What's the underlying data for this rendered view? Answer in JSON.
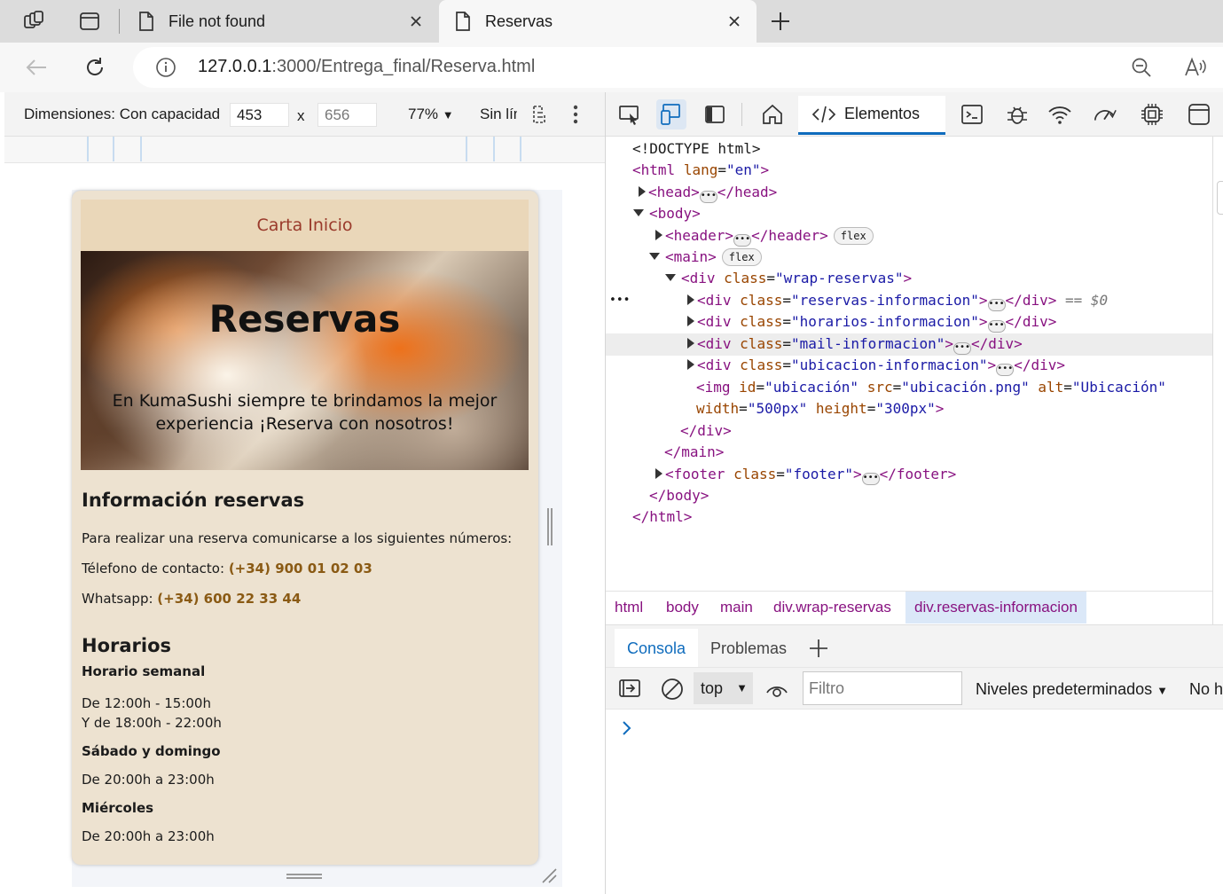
{
  "browser": {
    "tabs": [
      {
        "title": "File not found"
      },
      {
        "title": "Reservas"
      }
    ],
    "url": {
      "host": "127.0.0.1",
      "path": ":3000/Entrega_final/Reserva.html"
    }
  },
  "device_toolbar": {
    "dimensions_label": "Dimensiones: Con capacidad",
    "width": "453",
    "times": "x",
    "height": "656",
    "zoom": "77%",
    "throttle": "Sin límite"
  },
  "site": {
    "nav": [
      "Carta",
      "Inicio"
    ],
    "hero_title": "Reservas",
    "hero_text": "En KumaSushi siempre te brindamos la mejor experiencia ¡Reserva con nosotros!",
    "info_title": "Información reservas",
    "info_text": "Para realizar una reserva comunicarse a los siguientes números:",
    "phone_label": "Télefono de contacto:",
    "phone_value": "(+34) 900 01 02 03",
    "whatsapp_label": "Whatsapp:",
    "whatsapp_value": "(+34) 600 22 33 44",
    "hours_title": "Horarios",
    "weekly_title": "Horario semanal",
    "weekly_line1": "De 12:00h - 15:00h",
    "weekly_line2": "Y de 18:00h - 22:00h",
    "weekend_title": "Sábado y domingo",
    "weekend_text": "De 20:00h a 23:00h",
    "wednesday_title": "Miércoles",
    "wednesday_text": "De 20:00h a 23:00h"
  },
  "devtools": {
    "elements_tab": "Elementos",
    "dom": {
      "doctype": "<!DOCTYPE html>",
      "html_open": "<html",
      "lang_attr": "lang",
      "lang_val": "\"en\"",
      "head": "<head>",
      "head_close": "</head>",
      "body": "<body>",
      "header": "<header>",
      "header_close": "</header>",
      "flex": "flex",
      "main": "<main>",
      "div_open": "<div",
      "class_attr": "class",
      "wrap_val": "\"wrap-reservas\"",
      "reservas_val": "\"reservas-informacion\"",
      "horarios_val": "\"horarios-informacion\"",
      "mail_val": "\"mail-informacion\"",
      "ubicacion_val": "\"ubicacion-informacion\"",
      "div_close": "</div>",
      "selected_marker": "== $0",
      "img_open": "<img",
      "id_attr": "id",
      "id_val": "\"ubicación\"",
      "src_attr": "src",
      "src_val": "\"ubicación.png\"",
      "alt_attr": "alt",
      "alt_val": "\"Ubicación\"",
      "width_attr": "width",
      "width_val": "\"500px\"",
      "height_attr": "height",
      "height_val": "\"300px\"",
      "main_close": "</main>",
      "footer_open": "<footer",
      "footer_val": "\"footer\"",
      "footer_close": "</footer>",
      "body_close": "</body>",
      "html_close": "</html>"
    },
    "breadcrumbs": [
      "html",
      "body",
      "main",
      "div.wrap-reservas",
      "div.reservas-informacion"
    ],
    "drawer_tabs": [
      "Consola",
      "Problemas"
    ],
    "console": {
      "context": "top",
      "filter_placeholder": "Filtro",
      "levels": "Niveles predeterminados",
      "no_issues": "No hay problemas"
    }
  }
}
